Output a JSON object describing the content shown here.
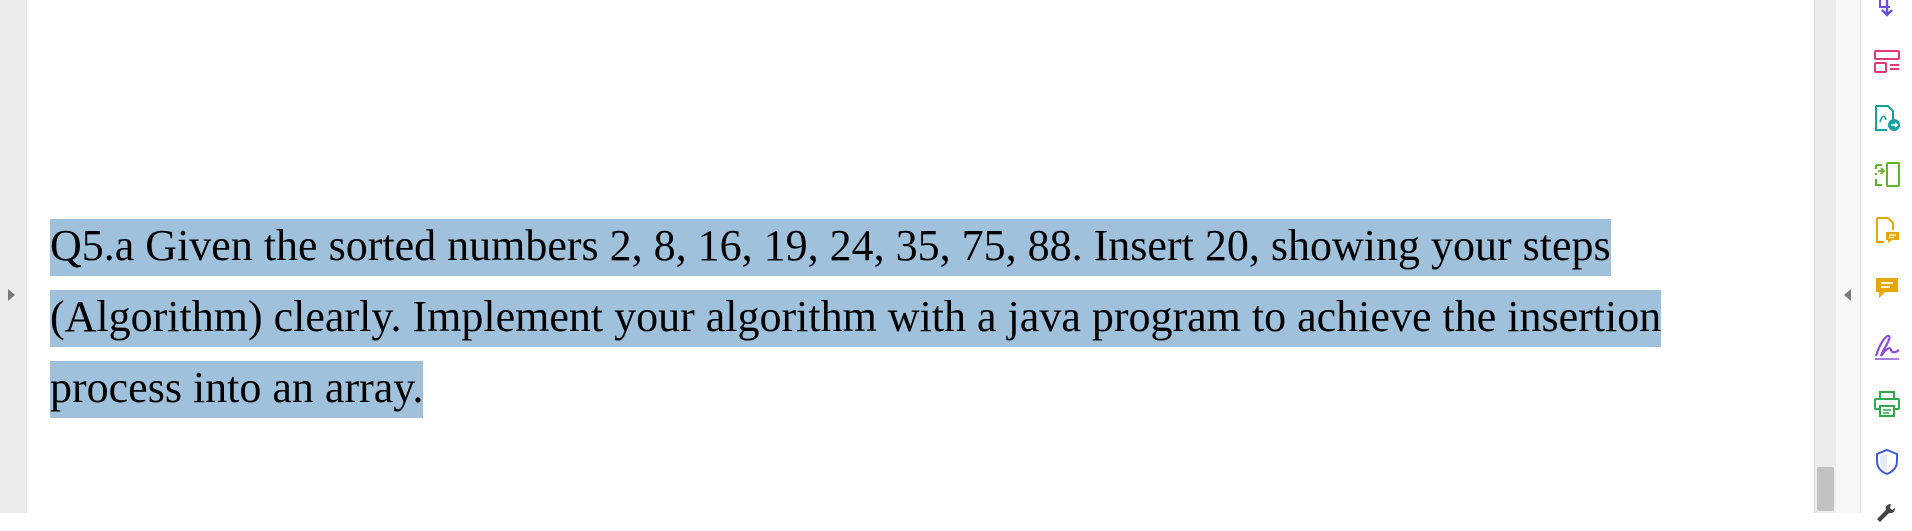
{
  "document": {
    "lines": [
      "Q5.a Given the sorted numbers 2, 8, 16, 19, 24, 35, 75, 88. Insert 20, showing your steps",
      "(Algorithm) clearly. Implement your algorithm with a java program to achieve the insertion",
      "process into an array."
    ],
    "highlight_color": "#9fc1dc"
  },
  "tools": [
    {
      "icon": "export-pdf-icon",
      "color": "#6b4fd8"
    },
    {
      "icon": "organize-pages-icon",
      "color": "#e0377d"
    },
    {
      "icon": "create-pdf-icon",
      "color": "#16a0a0"
    },
    {
      "icon": "compress-pdf-icon",
      "color": "#63b32d"
    },
    {
      "icon": "edit-pdf-icon",
      "color": "#e6a700"
    },
    {
      "icon": "comment-icon",
      "color": "#e6a700"
    },
    {
      "icon": "fill-sign-icon",
      "color": "#8a4fd8"
    },
    {
      "icon": "print-production-icon",
      "color": "#2fa84f"
    },
    {
      "icon": "protect-icon",
      "color": "#3f5bd8"
    },
    {
      "icon": "more-tools-icon",
      "color": "#444444"
    }
  ]
}
